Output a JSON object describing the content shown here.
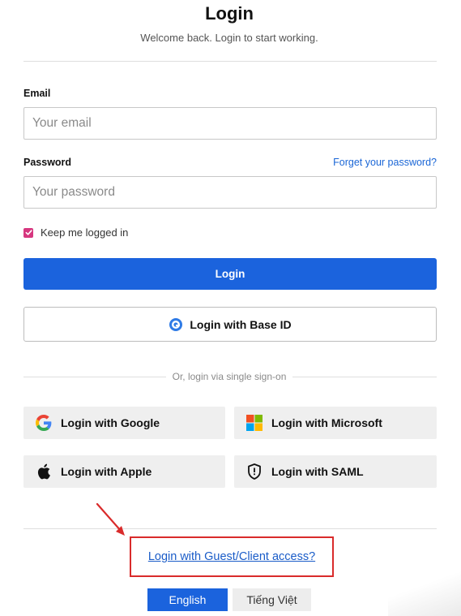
{
  "header": {
    "title": "Login",
    "subtitle": "Welcome back. Login to start working."
  },
  "form": {
    "email_label": "Email",
    "email_placeholder": "Your email",
    "password_label": "Password",
    "forgot_link": "Forget your password?",
    "password_placeholder": "Your password",
    "remember_label": "Keep me logged in",
    "remember_checked": true,
    "login_button": "Login",
    "base_id_button": "Login with Base ID"
  },
  "sso": {
    "divider_text": "Or, login via single sign-on",
    "buttons": [
      {
        "label": "Login with Google",
        "icon": "google-icon"
      },
      {
        "label": "Login with Microsoft",
        "icon": "microsoft-icon"
      },
      {
        "label": "Login with Apple",
        "icon": "apple-icon"
      },
      {
        "label": "Login with SAML",
        "icon": "shield-icon"
      }
    ]
  },
  "guest": {
    "link_text": "Login with Guest/Client access?"
  },
  "languages": {
    "options": [
      "English",
      "Tiếng Việt"
    ],
    "selected": "English"
  },
  "colors": {
    "primary": "#1b63dd",
    "checkbox": "#d6377f",
    "highlight_box": "#d92b2b"
  }
}
